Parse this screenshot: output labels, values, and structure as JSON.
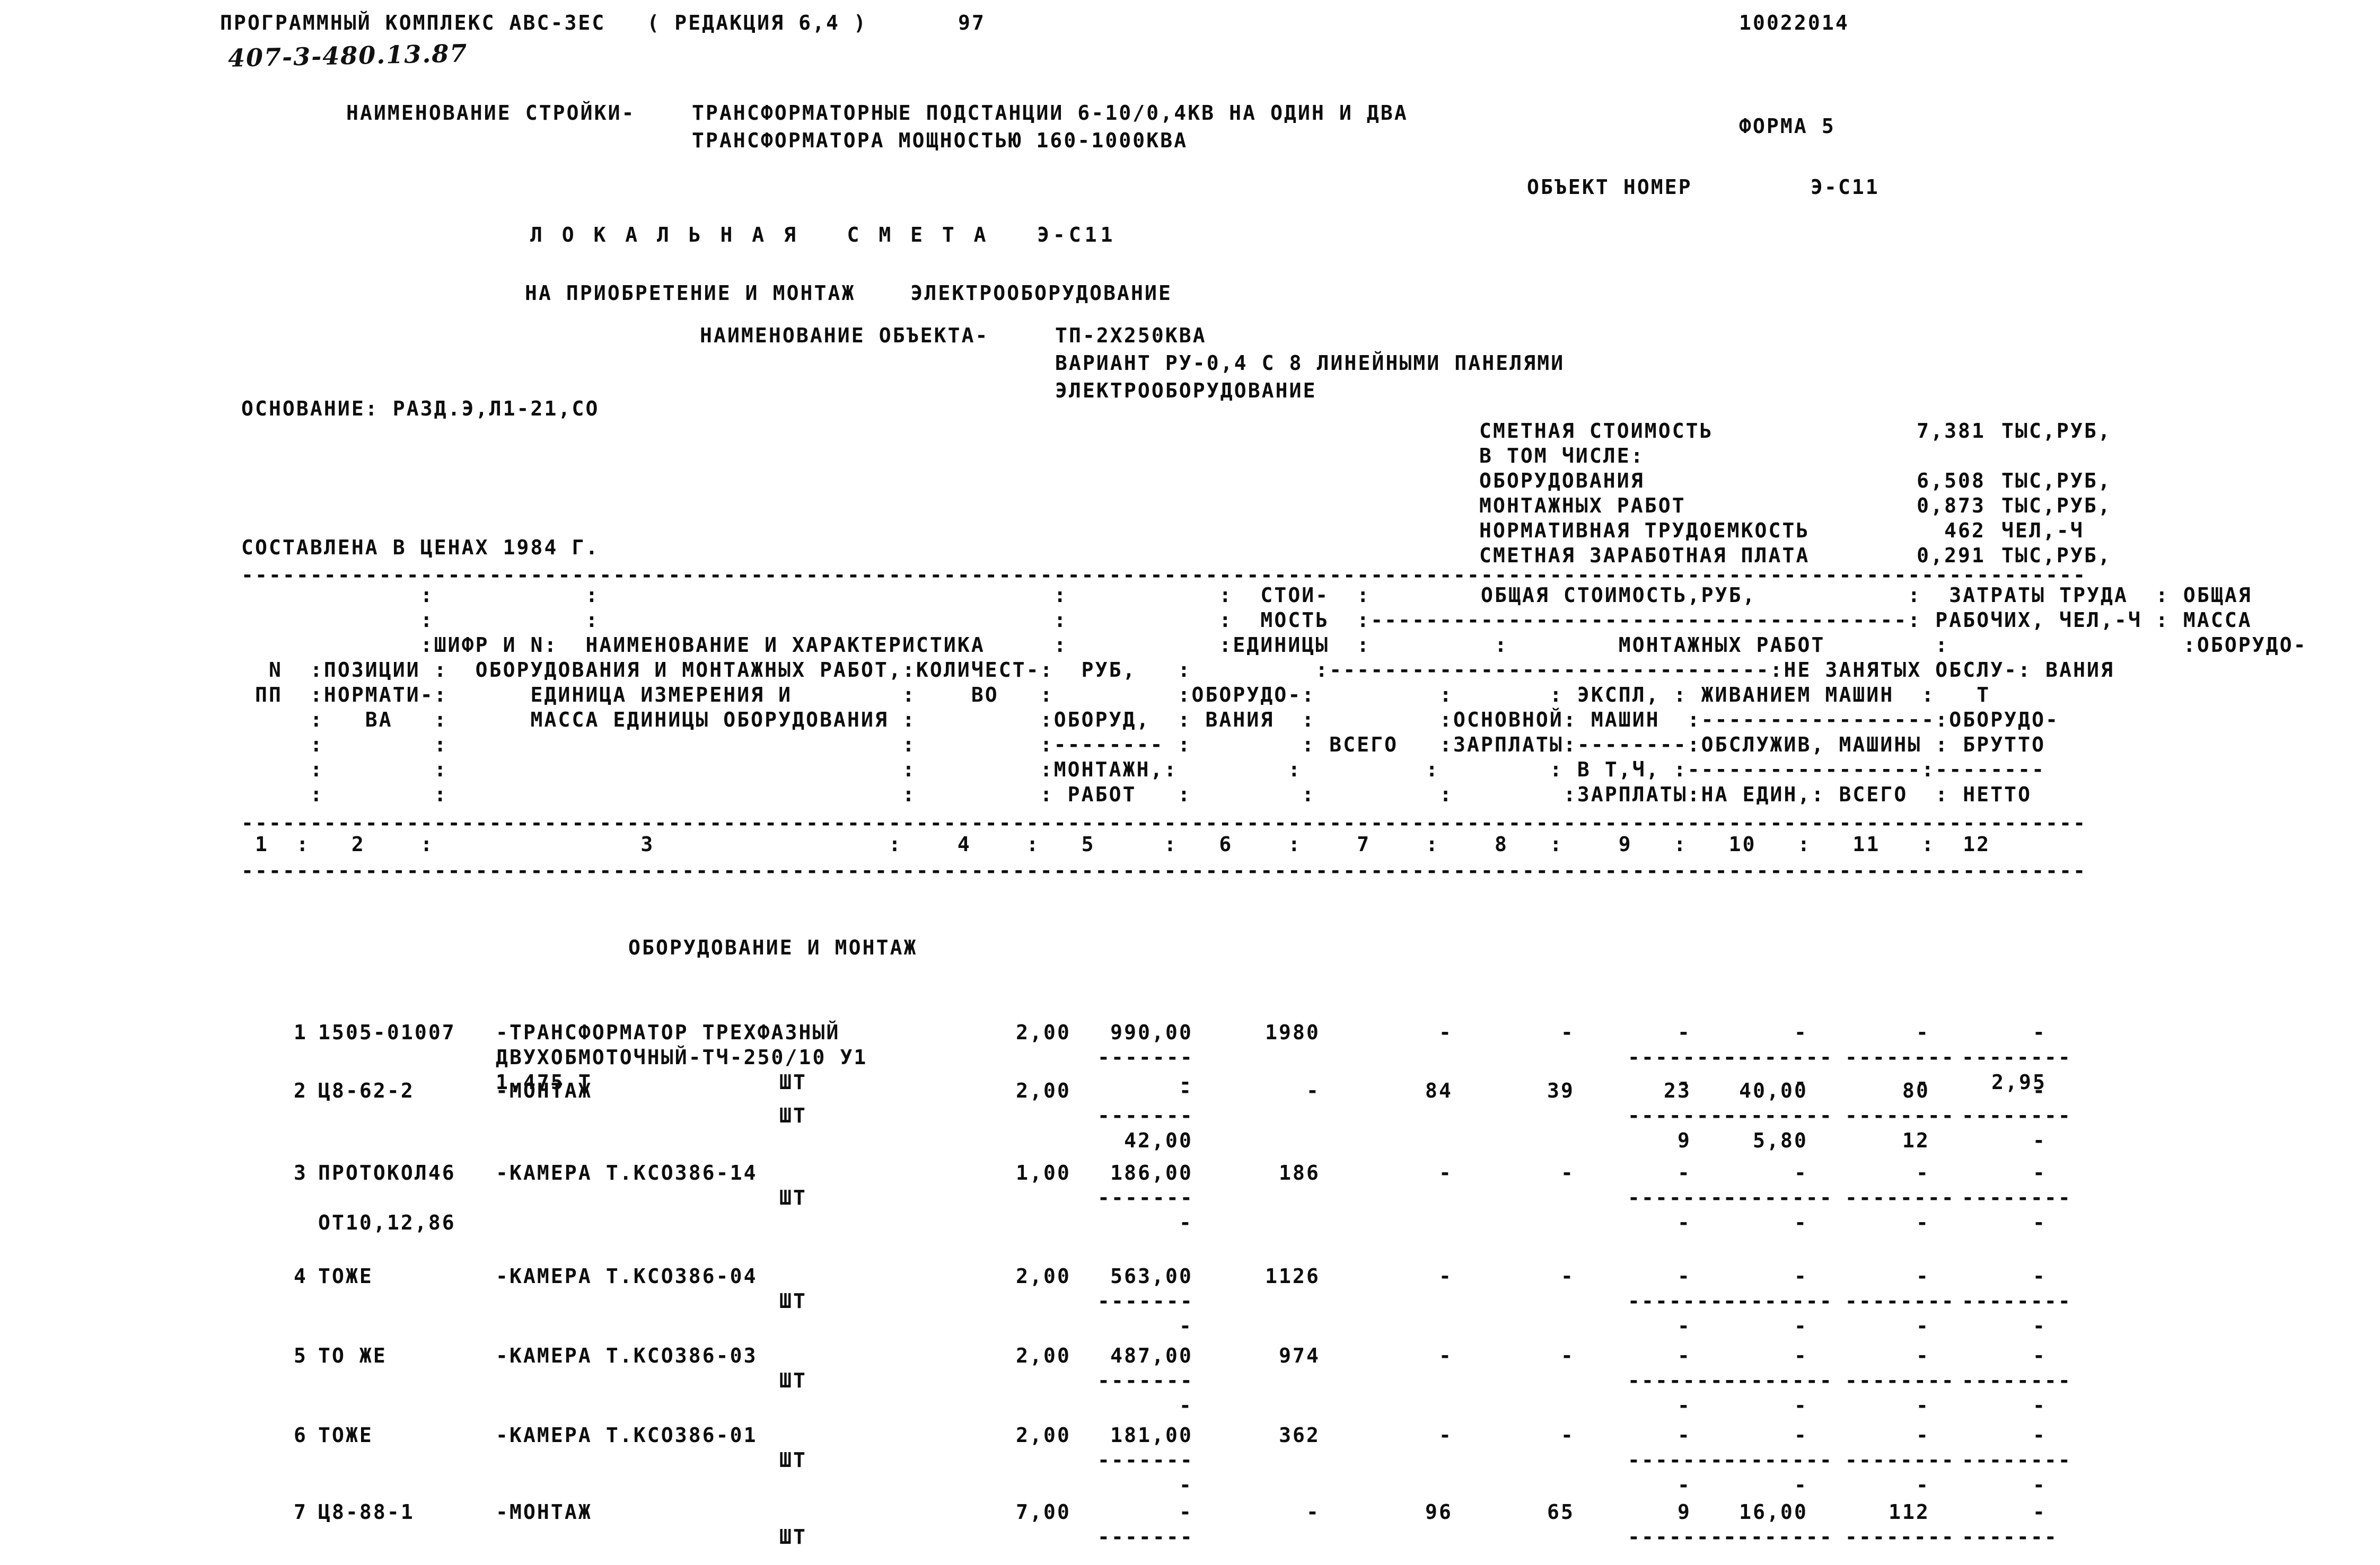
{
  "header": {
    "program_title": "ПРОГРАММНЫЙ КОМПЛЕКС АВС-3ЕС   ( РЕДАКЦИЯ 6,4 )",
    "handwritten_code": "407-3-480.13.87",
    "page_number": "97",
    "doc_number": "10022014",
    "form_label": "ФОРМА 5"
  },
  "site": {
    "label": "НАИМЕНОВАНИЕ СТРОЙКИ-",
    "line1": "ТРАНСФОРМАТОРНЫЕ ПОДСТАНЦИИ 6-10/0,4КВ НА ОДИН И ДВА",
    "line2": "ТРАНСФОРМАТОРА МОЩНОСТЬЮ 160-1000КВА"
  },
  "object": {
    "number_label": "ОБЪЕКТ НОМЕР",
    "number_value": "Э-С11",
    "title": "Л О К А Л Ь Н А Я   С М Е Т А   Э-С11",
    "purpose": "НА ПРИОБРЕТЕНИЕ И МОНТАЖ    ЭЛЕКТРООБОРУДОВАНИЕ",
    "name_label": "НАИМЕНОВАНИЕ ОБЪЕКТА-",
    "name_line1": "ТП-2Х250КВА",
    "name_line2": "ВАРИАНТ РУ-0,4 С 8 ЛИНЕЙНЫМИ ПАНЕЛЯМИ",
    "name_line3": "ЭЛЕКТРООБОРУДОВАНИЕ"
  },
  "basis": {
    "line": "ОСНОВАНИЕ: РАЗД.Э,Л1-21,СО",
    "prices_line": "СОСТАВЛЕНА В ЦЕНАХ 1984 Г."
  },
  "summary": {
    "rows": [
      {
        "label": "СМЕТНАЯ СТОИМОСТЬ",
        "value": "7,381",
        "unit": "ТЫС,РУБ,"
      },
      {
        "label": "В ТОМ ЧИСЛЕ:",
        "value": "",
        "unit": ""
      },
      {
        "label": "ОБОРУДОВАНИЯ",
        "value": "6,508",
        "unit": "ТЫС,РУБ,"
      },
      {
        "label": "МОНТАЖНЫХ РАБОТ",
        "value": "0,873",
        "unit": "ТЫС,РУБ,"
      },
      {
        "label": "НОРМАТИВНАЯ ТРУДОЕМКОСТЬ",
        "value": "462",
        "unit": "ЧЕЛ,-Ч"
      },
      {
        "label": "СМЕТНАЯ ЗАРАБОТНАЯ ПЛАТА",
        "value": "0,291",
        "unit": "ТЫС,РУБ,"
      }
    ]
  },
  "table": {
    "header_lines": [
      "             :           :                                 :           :  СТОИ-  :        ОБЩАЯ СТОИМОСТЬ,РУБ,           :  ЗАТРАТЫ ТРУДА  : ОБЩАЯ",
      "             :           :                                 :           :  МОСТЬ  :---------------------------------------: РАБОЧИХ, ЧЕЛ,-Ч : МАССА",
      "             :ШИФР И N:  НАИМЕНОВАНИЕ И ХАРАКТЕРИСТИКА     :           :ЕДИНИЦЫ  :         :        МОНТАЖНЫХ РАБОТ        :                 :ОБОРУДО-",
      "  N  :ПОЗИЦИИ :  ОБОРУДОВАНИЯ И МОНТАЖНЫХ РАБОТ,:КОЛИЧЕСТ-:  РУБ,   :         :--------------------------------:НЕ ЗАНЯТЫХ ОБСЛУ-: ВАНИЯ",
      " ПП  :НОРМАТИ-:      ЕДИНИЦА ИЗМЕРЕНИЯ И        :    ВО   :         :ОБОРУДО-:         :       : ЭКСПЛ, : ЖИВАНИЕМ МАШИН  :   Т",
      "     :   ВА   :      МАССА ЕДИНИЦЫ ОБОРУДОВАНИЯ :         :ОБОРУД,  : ВАНИЯ  :         :ОСНОВНОЙ: МАШИН  :-----------------:ОБОРУДО-",
      "     :        :                                 :         :-------- :        : ВСЕГО   :ЗАРПЛАТЫ:--------:ОБСЛУЖИВ, МАШИНЫ : БРУТТО",
      "     :        :                                 :         :МОНТАЖН,:        :         :        : В Т,Ч, :-----------------:--------",
      "     :        :                                 :         : РАБОТ   :        :         :        :ЗАРПЛАТЫ:НА ЕДИН,: ВСЕГО  : НЕТТО"
    ],
    "column_numbers": " 1  :   2    :               3                 :    4    :   5     :   6    :    7    :    8   :    9   :   10   :   11   :  12",
    "section_title": "ОБОРУДОВАНИЕ И МОНТАЖ",
    "rows": [
      {
        "no": "1",
        "code": "1505-01007",
        "desc1": "-ТРАНСФОРМАТОР ТРЕХФАЗНЫЙ",
        "desc2": "ДВУХОБМОТОЧНЫЙ-ТЧ-250/10 У1",
        "desc3": "1,475 Т",
        "unit": "ШТ",
        "qty": "2,00",
        "price": "990,00",
        "price_dash": "-------",
        "price2": "-",
        "c6": "1980",
        "c7": "-",
        "c8": "-",
        "c9": "-",
        "c10": "-",
        "c11": "-",
        "c12": "-",
        "c9_dash": "--------",
        "c10_dash": "--------",
        "c11_dash": "--------",
        "c12_dash": "--------",
        "c9b": "-",
        "c10b": "-",
        "c11b": "-",
        "c12b": "2,95"
      },
      {
        "no": "2",
        "code": "Ц8-62-2",
        "desc1": "-МОНТАЖ",
        "unit": "ШТ",
        "qty": "2,00",
        "price": "-",
        "price_dash": "-------",
        "price2": "42,00",
        "c6": "-",
        "c7": "84",
        "c8": "39",
        "c9": "23",
        "c10": "40,00",
        "c11": "80",
        "c12": "-",
        "c9_dash": "--------",
        "c10_dash": "--------",
        "c11_dash": "--------",
        "c12_dash": "--------",
        "c9b": "9",
        "c10b": "5,80",
        "c11b": "12",
        "c12b": "-"
      },
      {
        "no": "3",
        "code": "ПРОТОКОЛ46",
        "desc1": "-КАМЕРА Т.КСО386-14",
        "desc2": "ОТ10,12,86",
        "unit": "ШТ",
        "qty": "1,00",
        "price": "186,00",
        "price_dash": "-------",
        "price2": "-",
        "c6": "186",
        "c7": "-",
        "c8": "-",
        "c9": "-",
        "c10": "-",
        "c11": "-",
        "c12": "-",
        "c9_dash": "--------",
        "c10_dash": "--------",
        "c11_dash": "--------",
        "c12_dash": "--------",
        "c9b": "-",
        "c10b": "-",
        "c11b": "-",
        "c12b": "-"
      },
      {
        "no": "4",
        "code": "ТОЖЕ",
        "desc1": "-КАМЕРА Т.КСО386-04",
        "unit": "ШТ",
        "qty": "2,00",
        "price": "563,00",
        "price_dash": "-------",
        "price2": "-",
        "c6": "1126",
        "c7": "-",
        "c8": "-",
        "c9": "-",
        "c10": "-",
        "c11": "-",
        "c12": "-",
        "c9_dash": "--------",
        "c10_dash": "--------",
        "c11_dash": "--------",
        "c12_dash": "--------",
        "c9b": "-",
        "c10b": "-",
        "c11b": "-",
        "c12b": "-"
      },
      {
        "no": "5",
        "code": "ТО ЖЕ",
        "desc1": "-КАМЕРА Т.КСО386-03",
        "unit": "ШТ",
        "qty": "2,00",
        "price": "487,00",
        "price_dash": "-------",
        "price2": "-",
        "c6": "974",
        "c7": "-",
        "c8": "-",
        "c9": "-",
        "c10": "-",
        "c11": "-",
        "c12": "-",
        "c9_dash": "--------",
        "c10_dash": "--------",
        "c11_dash": "--------",
        "c12_dash": "--------",
        "c9b": "-",
        "c10b": "-",
        "c11b": "-",
        "c12b": "-"
      },
      {
        "no": "6",
        "code": "ТОЖЕ",
        "desc1": "-КАМЕРА Т.КСО386-01",
        "unit": "ШТ",
        "qty": "2,00",
        "price": "181,00",
        "price_dash": "-------",
        "price2": "-",
        "c6": "362",
        "c7": "-",
        "c8": "-",
        "c9": "-",
        "c10": "-",
        "c11": "-",
        "c12": "-",
        "c9_dash": "--------",
        "c10_dash": "--------",
        "c11_dash": "--------",
        "c12_dash": "--------",
        "c9b": "-",
        "c10b": "-",
        "c11b": "-",
        "c12b": "-"
      },
      {
        "no": "7",
        "code": "Ц8-88-1",
        "desc1": "-МОНТАЖ",
        "unit": "ШТ",
        "qty": "7,00",
        "price": "-",
        "price_dash": "-------",
        "price2": "",
        "c6": "-",
        "c7": "96",
        "c8": "65",
        "c9": "9",
        "c10": "16,00",
        "c11": "112",
        "c12": "-",
        "c9_dash": "--------",
        "c10_dash": "--------",
        "c11_dash": "--------",
        "c12_dash": "-------",
        "c9b": "",
        "c10b": "",
        "c11b": "",
        "c12b": ""
      }
    ]
  },
  "dividers": {
    "long": "--------------------------------------------------------------------------------------------------------------------------------------"
  }
}
